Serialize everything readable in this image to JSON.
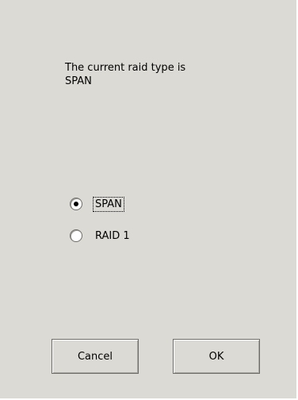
{
  "message": {
    "line1": "The current raid type is",
    "line2": "SPAN"
  },
  "raid_options": [
    {
      "label": "SPAN",
      "selected": true
    },
    {
      "label": "RAID 1",
      "selected": false
    }
  ],
  "buttons": {
    "cancel_label": "Cancel",
    "ok_label": "OK"
  },
  "colors": {
    "dialog_background": "#dcdad5"
  }
}
